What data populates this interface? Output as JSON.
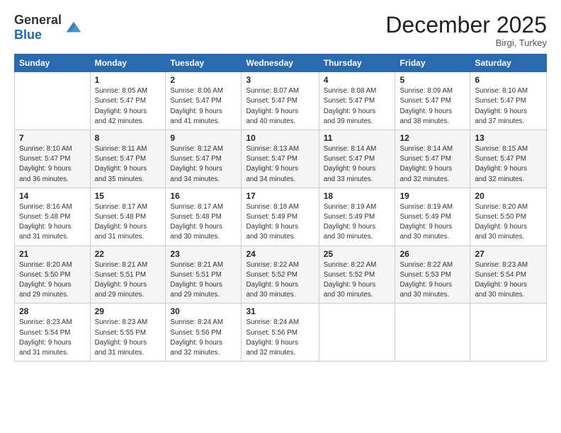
{
  "logo": {
    "text_general": "General",
    "text_blue": "Blue"
  },
  "title": "December 2025",
  "subtitle": "Birgi, Turkey",
  "days_of_week": [
    "Sunday",
    "Monday",
    "Tuesday",
    "Wednesday",
    "Thursday",
    "Friday",
    "Saturday"
  ],
  "weeks": [
    [
      {
        "num": "",
        "info": ""
      },
      {
        "num": "1",
        "info": "Sunrise: 8:05 AM\nSunset: 5:47 PM\nDaylight: 9 hours\nand 42 minutes."
      },
      {
        "num": "2",
        "info": "Sunrise: 8:06 AM\nSunset: 5:47 PM\nDaylight: 9 hours\nand 41 minutes."
      },
      {
        "num": "3",
        "info": "Sunrise: 8:07 AM\nSunset: 5:47 PM\nDaylight: 9 hours\nand 40 minutes."
      },
      {
        "num": "4",
        "info": "Sunrise: 8:08 AM\nSunset: 5:47 PM\nDaylight: 9 hours\nand 39 minutes."
      },
      {
        "num": "5",
        "info": "Sunrise: 8:09 AM\nSunset: 5:47 PM\nDaylight: 9 hours\nand 38 minutes."
      },
      {
        "num": "6",
        "info": "Sunrise: 8:10 AM\nSunset: 5:47 PM\nDaylight: 9 hours\nand 37 minutes."
      }
    ],
    [
      {
        "num": "7",
        "info": "Sunrise: 8:10 AM\nSunset: 5:47 PM\nDaylight: 9 hours\nand 36 minutes."
      },
      {
        "num": "8",
        "info": "Sunrise: 8:11 AM\nSunset: 5:47 PM\nDaylight: 9 hours\nand 35 minutes."
      },
      {
        "num": "9",
        "info": "Sunrise: 8:12 AM\nSunset: 5:47 PM\nDaylight: 9 hours\nand 34 minutes."
      },
      {
        "num": "10",
        "info": "Sunrise: 8:13 AM\nSunset: 5:47 PM\nDaylight: 9 hours\nand 34 minutes."
      },
      {
        "num": "11",
        "info": "Sunrise: 8:14 AM\nSunset: 5:47 PM\nDaylight: 9 hours\nand 33 minutes."
      },
      {
        "num": "12",
        "info": "Sunrise: 8:14 AM\nSunset: 5:47 PM\nDaylight: 9 hours\nand 32 minutes."
      },
      {
        "num": "13",
        "info": "Sunrise: 8:15 AM\nSunset: 5:47 PM\nDaylight: 9 hours\nand 32 minutes."
      }
    ],
    [
      {
        "num": "14",
        "info": "Sunrise: 8:16 AM\nSunset: 5:48 PM\nDaylight: 9 hours\nand 31 minutes."
      },
      {
        "num": "15",
        "info": "Sunrise: 8:17 AM\nSunset: 5:48 PM\nDaylight: 9 hours\nand 31 minutes."
      },
      {
        "num": "16",
        "info": "Sunrise: 8:17 AM\nSunset: 5:48 PM\nDaylight: 9 hours\nand 30 minutes."
      },
      {
        "num": "17",
        "info": "Sunrise: 8:18 AM\nSunset: 5:49 PM\nDaylight: 9 hours\nand 30 minutes."
      },
      {
        "num": "18",
        "info": "Sunrise: 8:19 AM\nSunset: 5:49 PM\nDaylight: 9 hours\nand 30 minutes."
      },
      {
        "num": "19",
        "info": "Sunrise: 8:19 AM\nSunset: 5:49 PM\nDaylight: 9 hours\nand 30 minutes."
      },
      {
        "num": "20",
        "info": "Sunrise: 8:20 AM\nSunset: 5:50 PM\nDaylight: 9 hours\nand 30 minutes."
      }
    ],
    [
      {
        "num": "21",
        "info": "Sunrise: 8:20 AM\nSunset: 5:50 PM\nDaylight: 9 hours\nand 29 minutes."
      },
      {
        "num": "22",
        "info": "Sunrise: 8:21 AM\nSunset: 5:51 PM\nDaylight: 9 hours\nand 29 minutes."
      },
      {
        "num": "23",
        "info": "Sunrise: 8:21 AM\nSunset: 5:51 PM\nDaylight: 9 hours\nand 29 minutes."
      },
      {
        "num": "24",
        "info": "Sunrise: 8:22 AM\nSunset: 5:52 PM\nDaylight: 9 hours\nand 30 minutes."
      },
      {
        "num": "25",
        "info": "Sunrise: 8:22 AM\nSunset: 5:52 PM\nDaylight: 9 hours\nand 30 minutes."
      },
      {
        "num": "26",
        "info": "Sunrise: 8:22 AM\nSunset: 5:53 PM\nDaylight: 9 hours\nand 30 minutes."
      },
      {
        "num": "27",
        "info": "Sunrise: 8:23 AM\nSunset: 5:54 PM\nDaylight: 9 hours\nand 30 minutes."
      }
    ],
    [
      {
        "num": "28",
        "info": "Sunrise: 8:23 AM\nSunset: 5:54 PM\nDaylight: 9 hours\nand 31 minutes."
      },
      {
        "num": "29",
        "info": "Sunrise: 8:23 AM\nSunset: 5:55 PM\nDaylight: 9 hours\nand 31 minutes."
      },
      {
        "num": "30",
        "info": "Sunrise: 8:24 AM\nSunset: 5:56 PM\nDaylight: 9 hours\nand 32 minutes."
      },
      {
        "num": "31",
        "info": "Sunrise: 8:24 AM\nSunset: 5:56 PM\nDaylight: 9 hours\nand 32 minutes."
      },
      {
        "num": "",
        "info": ""
      },
      {
        "num": "",
        "info": ""
      },
      {
        "num": "",
        "info": ""
      }
    ]
  ]
}
